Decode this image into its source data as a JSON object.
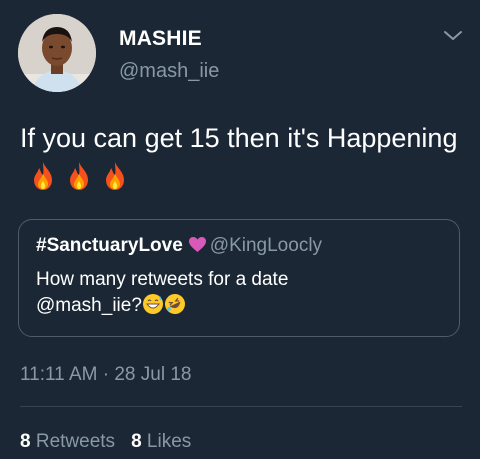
{
  "author": {
    "display_name": "MASHIE",
    "handle": "@mash_iie"
  },
  "tweet": {
    "text": "If you can get 15 then it's Happening",
    "emojis": [
      "fire-icon",
      "fire-icon",
      "fire-icon"
    ]
  },
  "quoted_tweet": {
    "author_name": "#SanctuaryLove",
    "name_emoji": "purple-heart-icon",
    "handle": "@KingLoocly",
    "text_line1": "How many retweets for a date",
    "text_line2": "@mash_iie?",
    "emojis": [
      "grinning-sweat-icon",
      "rolling-laughing-icon"
    ]
  },
  "timestamp": "11:11 AM · 28 Jul 18",
  "stats": {
    "retweets_count": "8",
    "retweets_label": "Retweets",
    "likes_count": "8",
    "likes_label": "Likes"
  },
  "colors": {
    "background": "#1b2734",
    "secondary_text": "#8899a6",
    "divider": "#38444d",
    "heart": "#e0245e"
  }
}
